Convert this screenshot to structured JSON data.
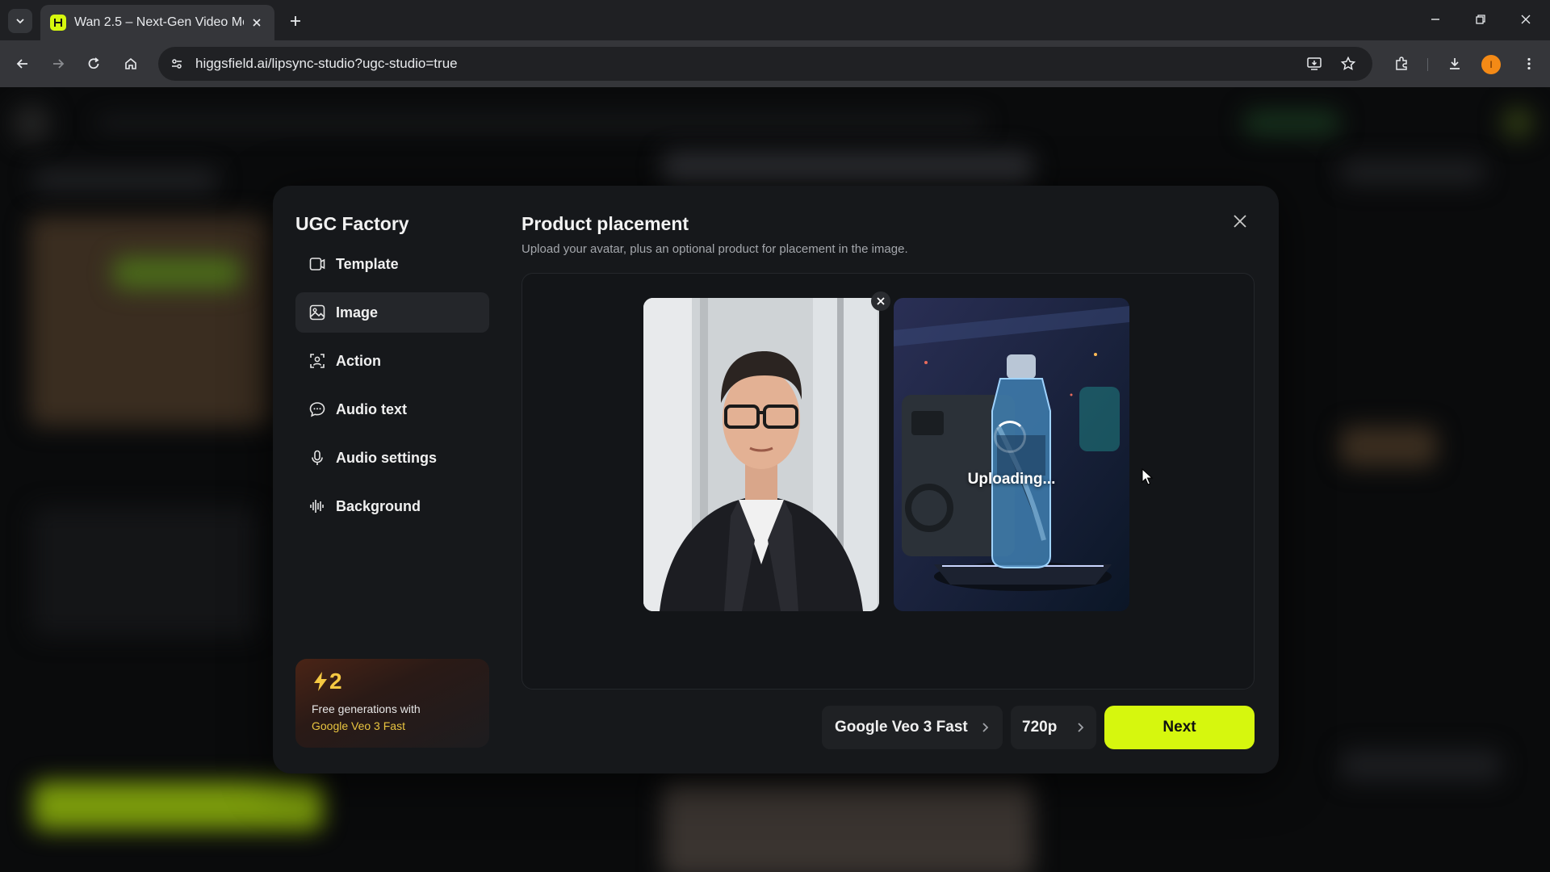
{
  "browser": {
    "tab_title": "Wan 2.5 – Next-Gen Video Mod",
    "url": "higgsfield.ai/lipsync-studio?ugc-studio=true",
    "profile_initial": "I"
  },
  "modal": {
    "brand": "UGC Factory",
    "title": "Product placement",
    "subtitle": "Upload your avatar, plus an optional product for placement in the image.",
    "nav": [
      {
        "label": "Template",
        "icon": "template-icon",
        "active": false
      },
      {
        "label": "Image",
        "icon": "image-icon",
        "active": true
      },
      {
        "label": "Action",
        "icon": "action-icon",
        "active": false
      },
      {
        "label": "Audio text",
        "icon": "chat-bubble-icon",
        "active": false
      },
      {
        "label": "Audio settings",
        "icon": "microphone-icon",
        "active": false
      },
      {
        "label": "Background",
        "icon": "waveform-icon",
        "active": false
      }
    ],
    "promo": {
      "count": "2",
      "text": "Free generations with",
      "model": "Google Veo 3 Fast"
    },
    "upload": {
      "status": "Uploading..."
    },
    "footer": {
      "model_label": "Google Veo 3 Fast",
      "resolution_label": "720p",
      "next_label": "Next"
    }
  },
  "colors": {
    "accent": "#d6f70e",
    "modal_bg": "#16181b",
    "promo_yellow": "#f5c842"
  }
}
